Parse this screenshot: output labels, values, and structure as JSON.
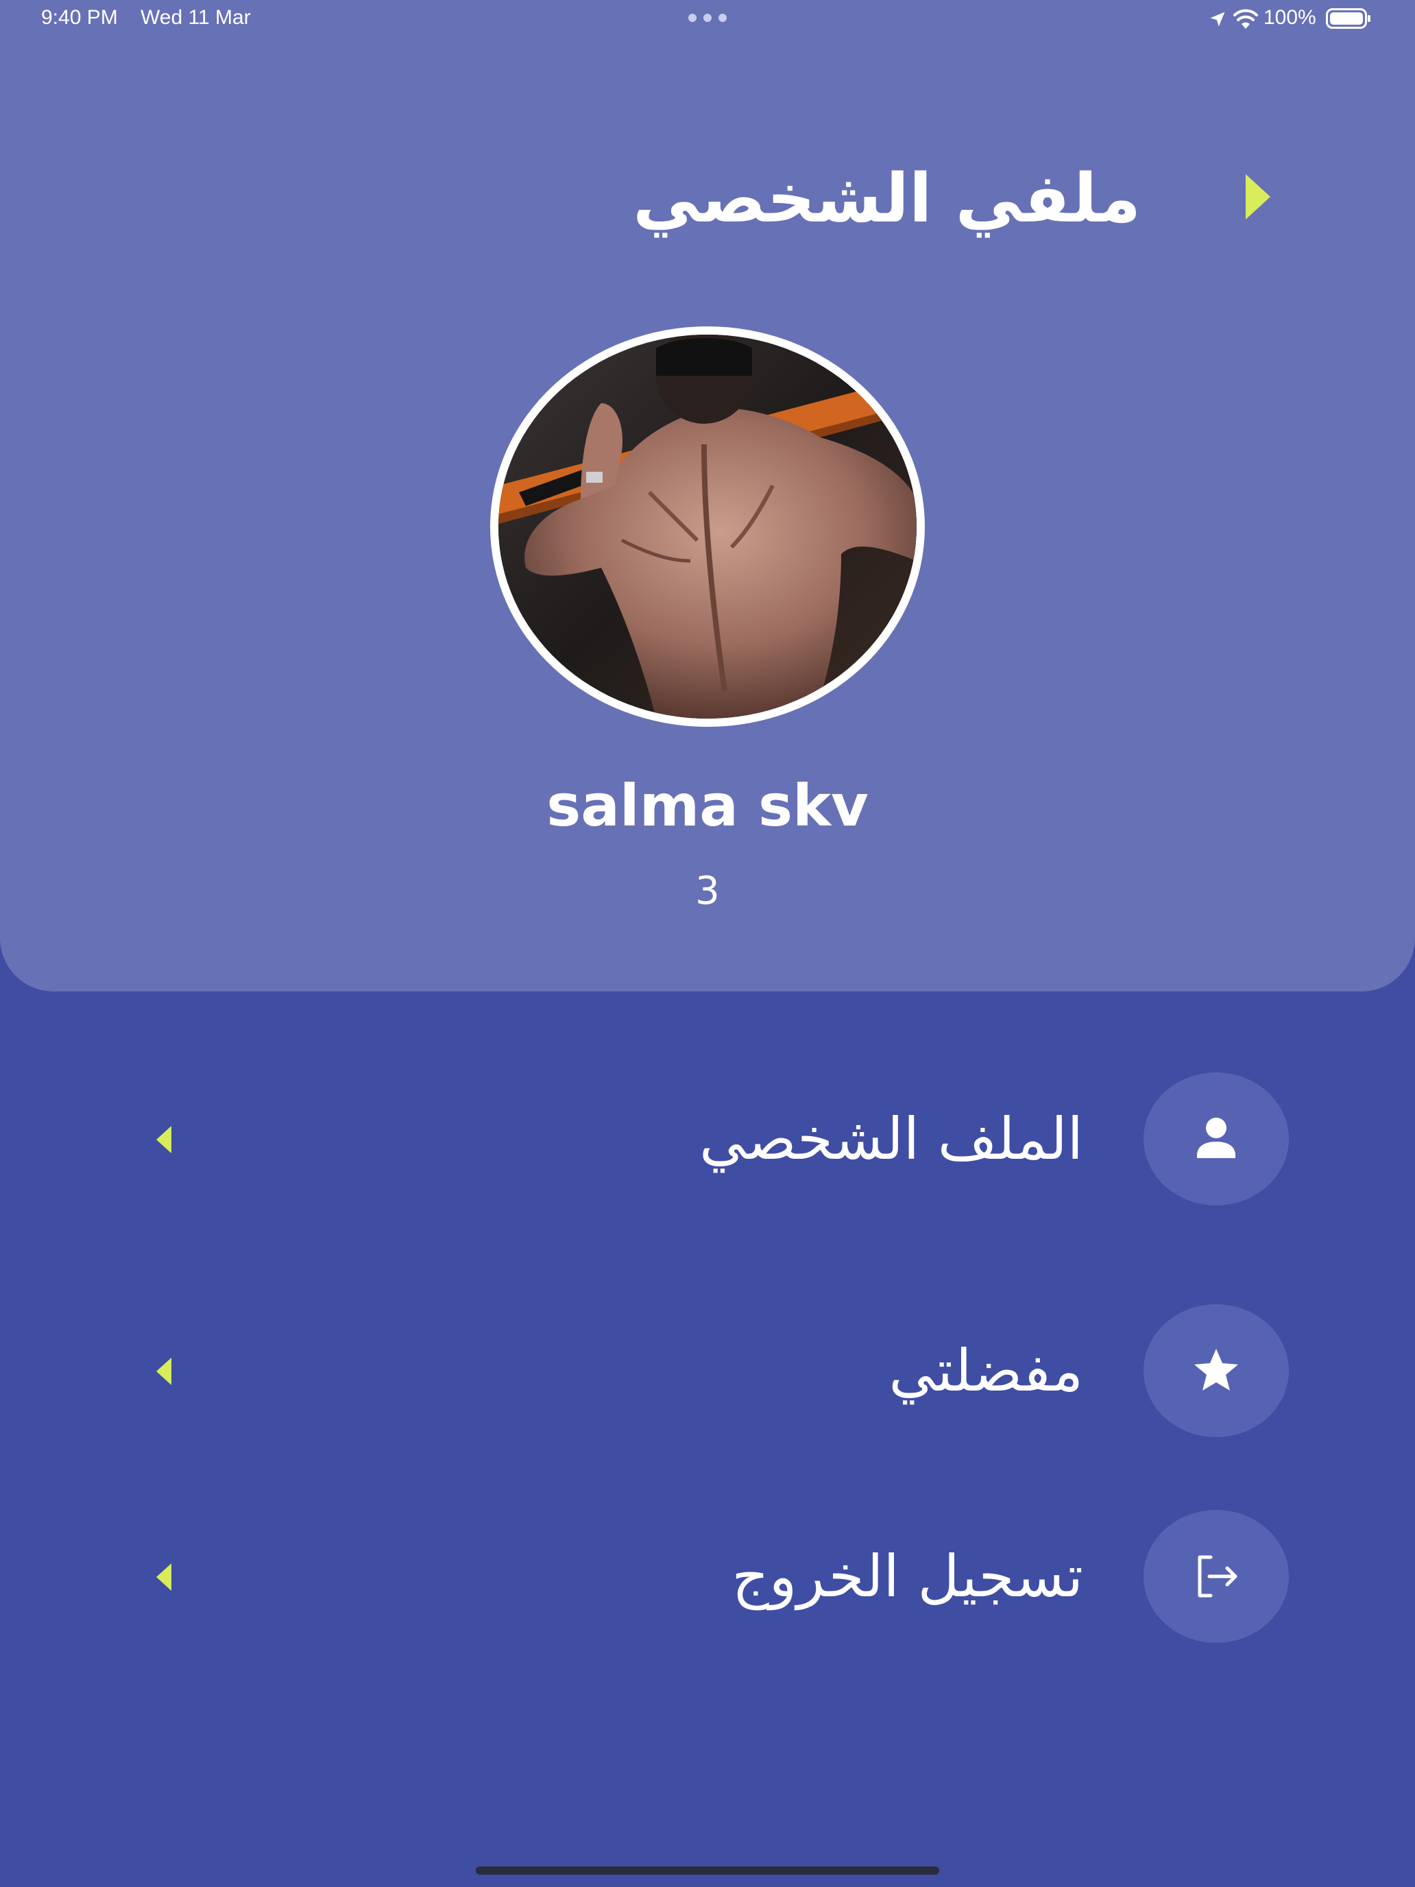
{
  "status_bar": {
    "time": "9:40 PM",
    "date": "Wed 11 Mar",
    "battery": "100%",
    "icons": [
      "location-arrow-icon",
      "wifi-icon",
      "battery-icon"
    ]
  },
  "header": {
    "title": "ملفي الشخصي",
    "back_icon": "caret-right-icon"
  },
  "profile": {
    "name": "salma skv",
    "count": "3",
    "avatar_icon": "profile-photo"
  },
  "menu": {
    "items": [
      {
        "label": "الملف الشخصي",
        "icon": "person-icon"
      },
      {
        "label": "مفضلتي",
        "icon": "star-icon"
      },
      {
        "label": "تسجيل الخروج",
        "icon": "logout-icon"
      }
    ]
  },
  "colors": {
    "background": "#3f4da2",
    "header_panel": "#6771b5",
    "accent": "#d8ec5c",
    "icon_circle": "#5663b3"
  }
}
